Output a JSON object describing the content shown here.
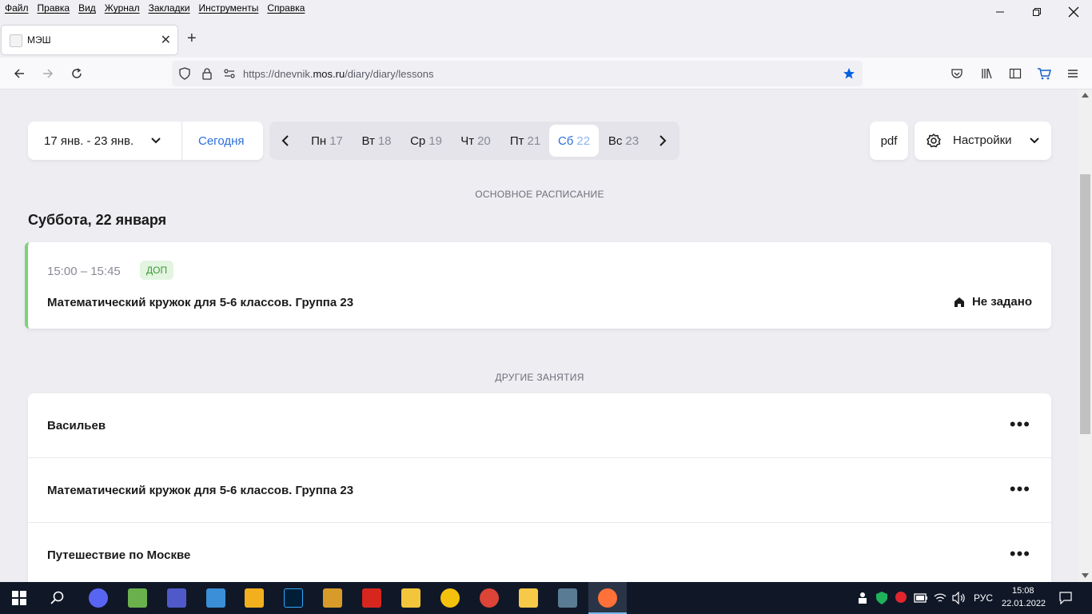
{
  "menubar": {
    "items": [
      "Файл",
      "Правка",
      "Вид",
      "Журнал",
      "Закладки",
      "Инструменты",
      "Справка"
    ]
  },
  "tab": {
    "title": "МЭШ"
  },
  "urlbar": {
    "prefix": "https://dnevnik.",
    "domain": "mos.ru",
    "path": "/diary/diary/lessons"
  },
  "toolbar": {
    "week_range": "17 янв. - 23 янв.",
    "today_label": "Сегодня",
    "pdf_label": "pdf",
    "settings_label": "Настройки",
    "days": [
      {
        "name": "Пн",
        "num": "17"
      },
      {
        "name": "Вт",
        "num": "18"
      },
      {
        "name": "Ср",
        "num": "19"
      },
      {
        "name": "Чт",
        "num": "20"
      },
      {
        "name": "Пт",
        "num": "21"
      },
      {
        "name": "Сб",
        "num": "22"
      },
      {
        "name": "Вс",
        "num": "23"
      }
    ]
  },
  "schedule": {
    "section_label": "ОСНОВНОЕ РАСПИСАНИЕ",
    "day_title": "Суббота, 22 января",
    "lesson": {
      "time": "15:00 – 15:45",
      "badge": "ДОП",
      "subject": "Математический кружок для 5-6 классов. Группа 23",
      "place": "Не задано"
    }
  },
  "other": {
    "section_label": "ДРУГИЕ ЗАНЯТИЯ",
    "items": [
      "Васильев",
      "Математический кружок для 5-6 классов. Группа 23",
      "Путешествие по Москве"
    ]
  },
  "taskbar": {
    "lang": "РУС",
    "time": "15:08",
    "date": "22.01.2022"
  },
  "colors": {
    "accent": "#2e6fd9",
    "badge_green": "#3b9a36",
    "lesson_border": "#7fd07a"
  }
}
